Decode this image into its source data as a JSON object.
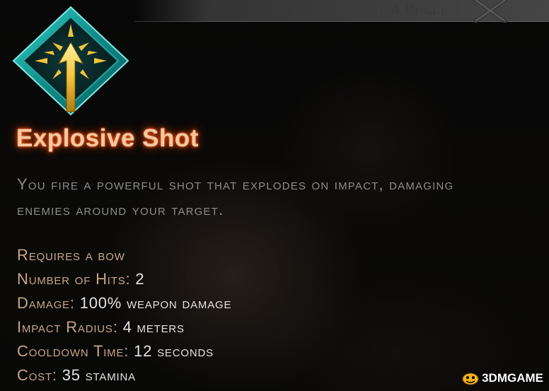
{
  "header": {
    "level_label": "Level 4 Rogue",
    "class_icon": "crossed-daggers-icon"
  },
  "ability": {
    "icon": "explosive-shot-arrow-icon",
    "name": "Explosive Shot",
    "description": "You fire a powerful shot that explodes on impact, damaging enemies around your target.",
    "requirement": "Requires a bow",
    "stats": [
      {
        "label": "Number of Hits:",
        "value": "2"
      },
      {
        "label": "Damage:",
        "value": "100% weapon damage"
      },
      {
        "label": "Impact Radius:",
        "value": "4 meters"
      },
      {
        "label": "Cooldown Time:",
        "value": "12 seconds"
      },
      {
        "label": "Cost:",
        "value": "35 stamina"
      }
    ]
  },
  "watermark": {
    "text": "3DMGAME",
    "icon": "3dm-logo-icon"
  },
  "colors": {
    "title_glow": "#ff5a10",
    "stat_label": "#c9a684",
    "stat_value": "#e2e2e2",
    "description": "#8d8d8d",
    "icon_teal": "#1aa6a2",
    "icon_gold": "#f2c43a"
  }
}
